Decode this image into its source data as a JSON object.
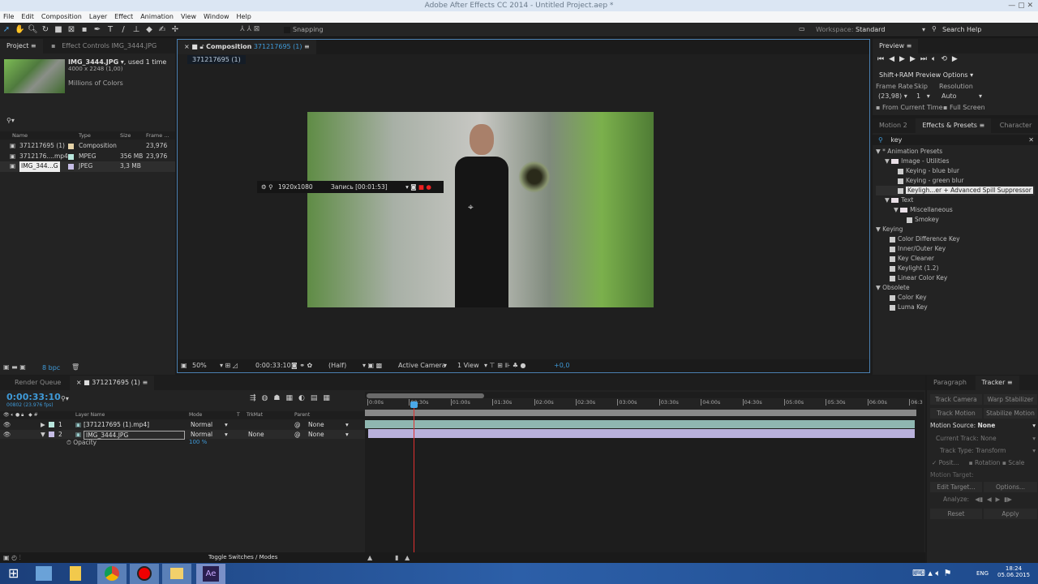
{
  "window": {
    "title": "Adobe After Effects CC 2014 - Untitled Project.aep *"
  },
  "menu": [
    "File",
    "Edit",
    "Composition",
    "Layer",
    "Effect",
    "Animation",
    "View",
    "Window",
    "Help"
  ],
  "toolbar": {
    "snapping": "Snapping",
    "workspace_label": "Workspace:",
    "workspace_value": "Standard",
    "search_help": "Search Help"
  },
  "project": {
    "tab": "Project",
    "effect_controls_tab": "Effect Controls",
    "effect_controls_target": "IMG_3444.JPG",
    "selected_name": "IMG_3444.JPG",
    "used": ", used 1 time",
    "dimensions": "4000 x 2248 (1,00)",
    "colors": "Millions of Colors",
    "bpc": "8 bpc",
    "columns": [
      "Name",
      "Type",
      "Size",
      "Frame ..."
    ],
    "items": [
      {
        "name": "371217695 (1)",
        "type": "Composition",
        "size": "",
        "frame": "23,976",
        "color": "#e6d3a8"
      },
      {
        "name": "3712176....mp4",
        "type": "MPEG",
        "size": "356 MB",
        "frame": "23,976",
        "color": "#b8e6dc"
      },
      {
        "name": "IMG_344...G",
        "type": "JPEG",
        "size": "3,3 MB",
        "frame": "",
        "color": "#c6bde6"
      }
    ]
  },
  "composition": {
    "tab_label": "Composition",
    "tab_name": "371217695 (1)",
    "breadcrumb": "371217695 (1)",
    "overlay_resolution": "1920x1080",
    "overlay_record": "Запись [00:01:53]",
    "footer": {
      "zoom": "50%",
      "time": "0:00:33:10",
      "resolution": "(Half)",
      "camera": "Active Camera",
      "views": "1 View",
      "exposure": "+0,0"
    }
  },
  "preview": {
    "tab": "Preview",
    "ram_options": "Shift+RAM Preview Options",
    "frame_rate_label": "Frame Rate",
    "frame_rate": "(23,98)",
    "skip_label": "Skip",
    "skip": "1",
    "resolution_label": "Resolution",
    "resolution": "Auto",
    "from_current": "From Current Time",
    "full_screen": "Full Screen"
  },
  "effects": {
    "tabs": [
      "Motion 2",
      "Effects & Presets",
      "Character"
    ],
    "search": "key",
    "tree": [
      {
        "label": "* Animation Presets",
        "level": 0,
        "kind": "group"
      },
      {
        "label": "Image - Utilities",
        "level": 1,
        "kind": "folder"
      },
      {
        "label": "Keying - blue blur",
        "level": 2,
        "kind": "preset"
      },
      {
        "label": "Keying - green blur",
        "level": 2,
        "kind": "preset"
      },
      {
        "label": "Keyligh...er + Advanced Spill Suppressor",
        "level": 2,
        "kind": "preset",
        "selected": true
      },
      {
        "label": "Text",
        "level": 1,
        "kind": "folder"
      },
      {
        "label": "Miscellaneous",
        "level": 2,
        "kind": "folder"
      },
      {
        "label": "Smokey",
        "level": 3,
        "kind": "preset"
      },
      {
        "label": "Keying",
        "level": 0,
        "kind": "group"
      },
      {
        "label": "Color Difference Key",
        "level": 1,
        "kind": "effect"
      },
      {
        "label": "Inner/Outer Key",
        "level": 1,
        "kind": "effect"
      },
      {
        "label": "Key Cleaner",
        "level": 1,
        "kind": "effect"
      },
      {
        "label": "Keylight (1.2)",
        "level": 1,
        "kind": "effect"
      },
      {
        "label": "Linear Color Key",
        "level": 1,
        "kind": "effect"
      },
      {
        "label": "Obsolete",
        "level": 0,
        "kind": "group"
      },
      {
        "label": "Color Key",
        "level": 1,
        "kind": "effect"
      },
      {
        "label": "Luma Key",
        "level": 1,
        "kind": "effect"
      }
    ]
  },
  "timeline": {
    "render_queue_tab": "Render Queue",
    "comp_tab": "371217695 (1)",
    "timecode": "0:00:33:10",
    "frame_info": "00802 (23.976 fps)",
    "columns": {
      "layer_name": "Layer Name",
      "mode": "Mode",
      "t": "T",
      "trkmat": "TrkMat",
      "parent": "Parent"
    },
    "layers": [
      {
        "num": "1",
        "name": "[371217695 (1).mp4]",
        "mode": "Normal",
        "trkmat": "",
        "parent": "None",
        "label_color": "#b8e6dc"
      },
      {
        "num": "2",
        "name": "IMG_3444.JPG",
        "mode": "Normal",
        "trkmat": "None",
        "parent": "None",
        "label_color": "#c6bde6"
      }
    ],
    "property": {
      "name": "Opacity",
      "value": "100 %"
    },
    "ruler": [
      "0:00s",
      "00:30s",
      "01:00s",
      "01:30s",
      "02:00s",
      "02:30s",
      "03:00s",
      "03:30s",
      "04:00s",
      "04:30s",
      "05:00s",
      "05:30s",
      "06:00s",
      "06:3"
    ],
    "toggle": "Toggle Switches / Modes"
  },
  "tracker": {
    "tabs": [
      "Paragraph",
      "Tracker"
    ],
    "track_camera": "Track Camera",
    "warp_stabilizer": "Warp Stabilizer",
    "track_motion": "Track Motion",
    "stabilize_motion": "Stabilize Motion",
    "motion_source_label": "Motion Source:",
    "motion_source": "None",
    "current_track_label": "Current Track:",
    "current_track": "None",
    "track_type_label": "Track Type:",
    "track_type": "Transform",
    "position": "Posit...",
    "rotation": "Rotation",
    "scale": "Scale",
    "motion_target": "Motion Target:",
    "edit_target": "Edit Target...",
    "options": "Options...",
    "analyze": "Analyze:",
    "reset": "Reset",
    "apply": "Apply"
  },
  "taskbar": {
    "lang": "ENG",
    "time": "18:24",
    "date": "05.06.2015"
  }
}
